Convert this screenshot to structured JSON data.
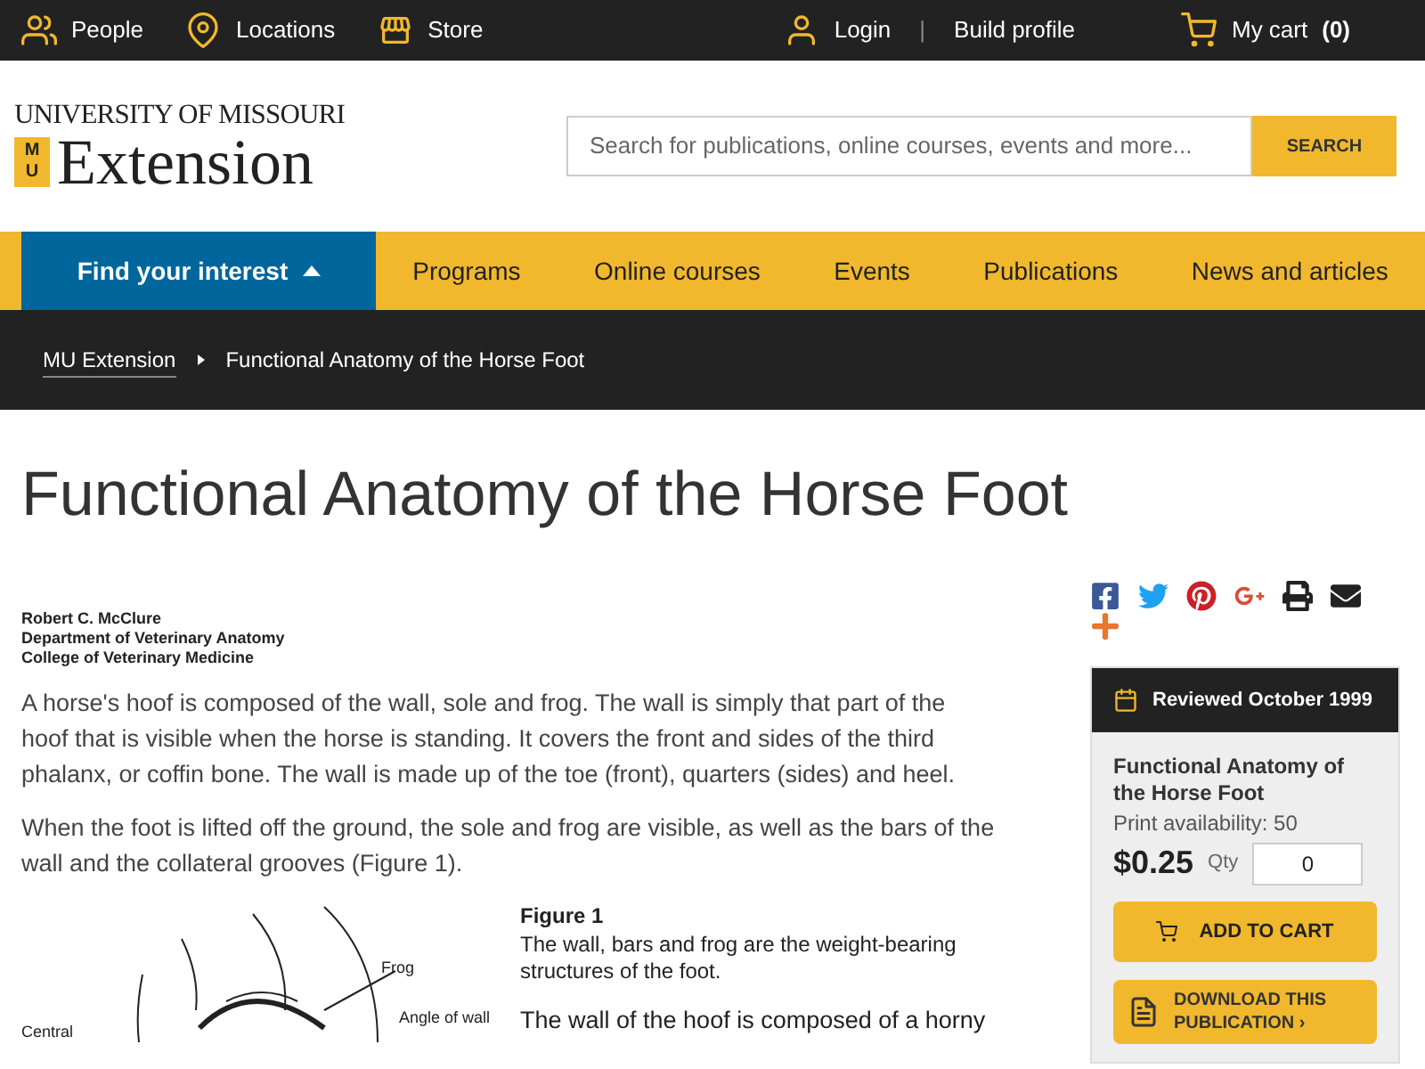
{
  "top_bar": {
    "left_links": [
      {
        "kind": "people",
        "label": "People"
      },
      {
        "kind": "location",
        "label": "Locations"
      },
      {
        "kind": "store",
        "label": "Store"
      }
    ],
    "login": "Login",
    "separator": "|",
    "build_profile": "Build profile",
    "cart": {
      "label": "My cart",
      "count": "(0)"
    }
  },
  "header": {
    "logo": {
      "line1": "UNIVERSITY OF MISSOURI",
      "line2": "Extension",
      "mark_top": "M",
      "mark_bottom": "U"
    },
    "search": {
      "placeholder": "Search for publications, online courses, events and more...",
      "button": "SEARCH"
    }
  },
  "nav": {
    "interest": {
      "label": "Find your interest",
      "expanded": true
    },
    "items": [
      "Programs",
      "Online courses",
      "Events",
      "Publications",
      "News and articles"
    ]
  },
  "breadcrumb": [
    {
      "label": "MU Extension"
    },
    {
      "label": "Functional Anatomy of the Horse Foot"
    }
  ],
  "page_title": "Functional Anatomy of the Horse Foot",
  "author": [
    "Robert C. McClure",
    "Department of Veterinary Anatomy",
    "College of Veterinary Medicine"
  ],
  "paragraphs": [
    "A horse's hoof is composed of the wall, sole and frog. The wall is simply that part of the hoof that is visible when the horse is standing. It covers the front and sides of the third phalanx, or coffin bone. The wall is made up of the toe (front), quarters (sides) and heel.",
    "When the foot is lifted off the ground, the sole and frog are visible, as well as the bars of the wall and the collateral grooves (Figure 1)."
  ],
  "figure": {
    "labels": [
      "Frog",
      "Angle of wall",
      "Central"
    ],
    "title": "Figure 1",
    "caption": "The wall, bars and frog are the weight-bearing structures of the foot.",
    "next_text": "The wall of the hoof is composed of a horny"
  },
  "share": [
    {
      "kind": "facebook"
    },
    {
      "kind": "twitter"
    },
    {
      "kind": "pinterest"
    },
    {
      "kind": "googleplus"
    },
    {
      "kind": "print"
    },
    {
      "kind": "email"
    },
    {
      "kind": "more"
    }
  ],
  "product": {
    "reviewed": "Reviewed October 1999",
    "title": "Functional Anatomy of the Horse Foot",
    "availability": "Print availability: 50",
    "price": "$0.25",
    "qty_label": "Qty",
    "qty": "0",
    "add_to_cart": "ADD TO CART",
    "download": "DOWNLOAD THIS PUBLICATION ›"
  }
}
